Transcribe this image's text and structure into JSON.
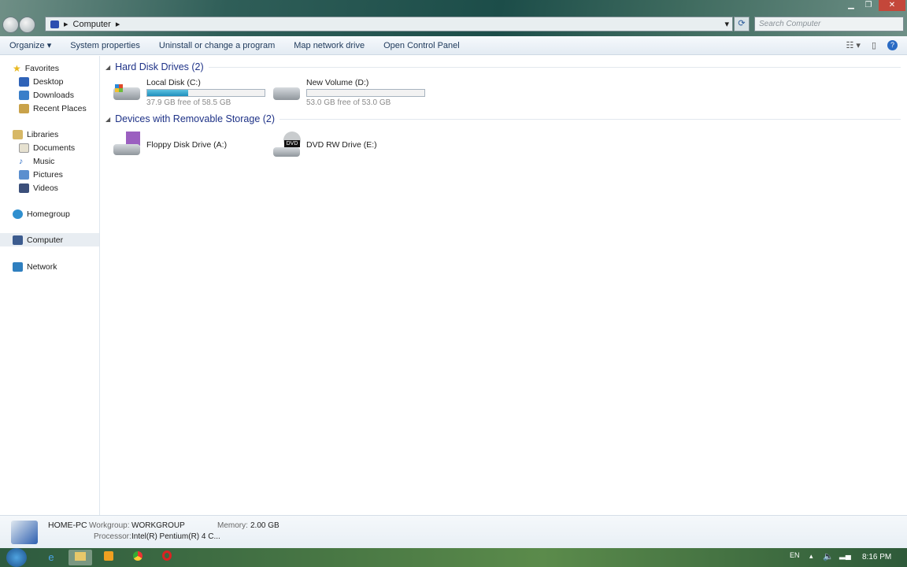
{
  "address": {
    "path": [
      "Computer"
    ],
    "search_placeholder": "Search Computer"
  },
  "toolbar": {
    "organize": "Organize ▾",
    "system_properties": "System properties",
    "uninstall": "Uninstall or change a program",
    "map_drive": "Map network drive",
    "control_panel": "Open Control Panel"
  },
  "sidebar": {
    "favorites": "Favorites",
    "desktop": "Desktop",
    "downloads": "Downloads",
    "recent": "Recent Places",
    "libraries": "Libraries",
    "documents": "Documents",
    "music": "Music",
    "pictures": "Pictures",
    "videos": "Videos",
    "homegroup": "Homegroup",
    "computer": "Computer",
    "network": "Network"
  },
  "groups": [
    {
      "title": "Hard Disk Drives (2)",
      "items": [
        {
          "name": "Local Disk (C:)",
          "free": "37.9 GB free of 58.5 GB",
          "used_fraction": 0.35
        },
        {
          "name": "New Volume (D:)",
          "free": "53.0 GB free of 53.0 GB",
          "used_fraction": 0.0
        }
      ]
    },
    {
      "title": "Devices with Removable Storage (2)",
      "items": [
        {
          "name": "Floppy Disk Drive (A:)"
        },
        {
          "name": "DVD RW Drive (E:)",
          "icon_label": "DVD"
        }
      ]
    }
  ],
  "details": {
    "pc_name": "HOME-PC",
    "workgroup_label": "Workgroup:",
    "workgroup": "WORKGROUP",
    "memory_label": "Memory:",
    "memory": "2.00 GB",
    "processor_label": "Processor:",
    "processor": "Intel(R) Pentium(R) 4 C..."
  },
  "taskbar": {
    "lang": "EN",
    "time": "8:16 PM",
    "icons": [
      "start-orb",
      "internet-explorer",
      "windows-explorer",
      "media-player",
      "chrome",
      "opera"
    ]
  },
  "colors": {
    "accent": "#1e3287",
    "progress": "#1d8fbd",
    "taskbar": "#4b7a45"
  }
}
